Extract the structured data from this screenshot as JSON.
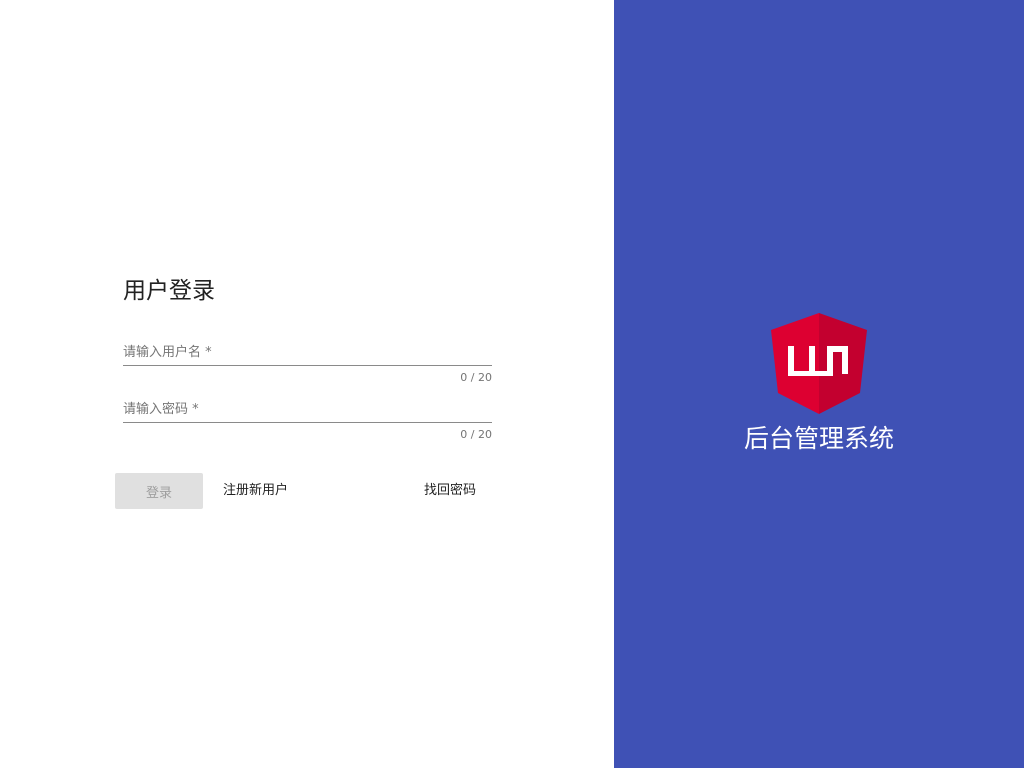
{
  "login": {
    "title": "用户登录",
    "username": {
      "placeholder": "请输入用户名 *",
      "value": "",
      "counter": "0 / 20"
    },
    "password": {
      "placeholder": "请输入密码 *",
      "value": "",
      "counter": "0 / 20"
    },
    "login_button": "登录",
    "register_link": "注册新用户",
    "forgot_link": "找回密码"
  },
  "brand": {
    "logo_icon": "angular-shield-logo-icon",
    "logo_color": "#dd0031",
    "system_name": "后台管理系统",
    "panel_color": "#3f51b5"
  }
}
